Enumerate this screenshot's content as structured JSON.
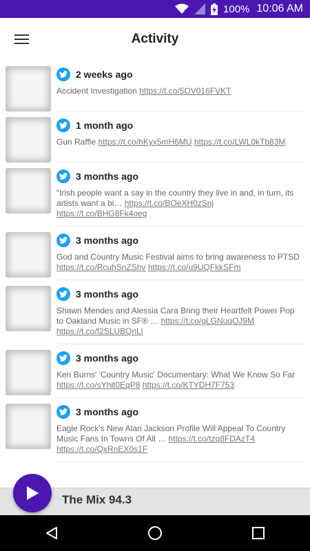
{
  "status_bar": {
    "battery": "100%",
    "time": "10:06 AM"
  },
  "app_bar": {
    "title": "Activity"
  },
  "feed": [
    {
      "ago": "2 weeks ago",
      "text": "Accident Investigation ",
      "links": [
        "https://t.co/5OV016FVKT"
      ]
    },
    {
      "ago": "1 month ago",
      "text": "Gun Raffle ",
      "links": [
        "https://t.co/hKyx5mH6MU",
        "https://t.co/LWL0kTb83M"
      ]
    },
    {
      "ago": "3 months ago",
      "text": "“Irish people want a say in the country they live in and, in turn, its artists want a bi… ",
      "links": [
        "https://t.co/BOeXH0zSnj",
        "https://t.co/BHG8Fk4oeg"
      ]
    },
    {
      "ago": "3 months ago",
      "text": "God and Country Music Festival aims to bring awareness to PTSD ",
      "links": [
        "https://t.co/RcuhSnZShv",
        "https://t.co/u9UQFkkSFm"
      ]
    },
    {
      "ago": "3 months ago",
      "text": "Shawn Mendes and Alessia Cara Bring their Heartfelt Power Pop to Oakland Music in SF® … ",
      "links": [
        "https://t.co/gLGNuqOJ9M",
        "https://t.co/f2SLUBQnLl"
      ]
    },
    {
      "ago": "3 months ago",
      "text": "Ken Burns' 'Country Music' Documentary: What We Know So Far ",
      "links": [
        "https://t.co/sYhlt0EqP8",
        "https://t.co/KTYDH7F753"
      ]
    },
    {
      "ago": "3 months ago",
      "text": "Eagle Rock's New Alan Jackson Profile Will Appeal To Country Music Fans In Towns Of All … ",
      "links": [
        "https://t.co/tzq8FDAzT4",
        "https://t.co/QxRnEX0s1F"
      ]
    }
  ],
  "player": {
    "station": "The Mix 94.3"
  },
  "colors": {
    "accent": "#4a17b0",
    "twitter": "#1da1f2"
  },
  "icons": {
    "status": [
      "wifi-icon",
      "signal-icon",
      "battery-icon"
    ],
    "nav": [
      "back-icon",
      "home-icon",
      "recents-icon"
    ]
  }
}
